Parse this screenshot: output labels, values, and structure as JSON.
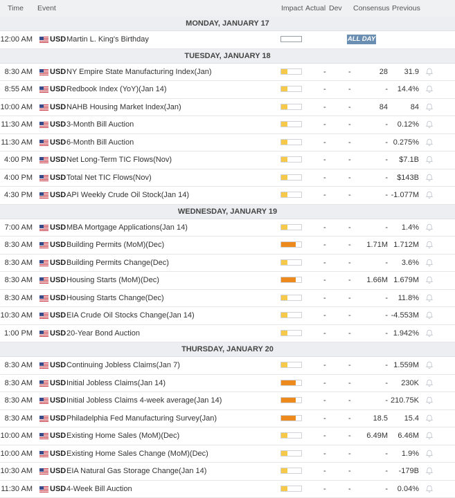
{
  "header": {
    "time": "Time",
    "event": "Event",
    "impact": "Impact",
    "actual": "Actual",
    "dev": "Dev",
    "consensus": "Consensus",
    "previous": "Previous"
  },
  "colors": {
    "impact_low": "#f6c94a",
    "impact_medium": "#ec8a1d",
    "all_day_badge": "#6b8eb3"
  },
  "days": [
    {
      "label": "MONDAY, JANUARY 17",
      "rows": [
        {
          "time": "12:00 AM",
          "currency": "USD",
          "event": "Martin L. King's Birthday",
          "impact": "none",
          "badge": "ALL DAY"
        }
      ]
    },
    {
      "label": "TUESDAY, JANUARY 18",
      "rows": [
        {
          "time": "8:30 AM",
          "currency": "USD",
          "event": "NY Empire State Manufacturing Index(Jan)",
          "impact": "low",
          "actual": "-",
          "dev": "-",
          "consensus": "28",
          "previous": "31.9"
        },
        {
          "time": "8:55 AM",
          "currency": "USD",
          "event": "Redbook Index (YoY)(Jan 14)",
          "impact": "low",
          "actual": "-",
          "dev": "-",
          "consensus": "-",
          "previous": "14.4%"
        },
        {
          "time": "10:00 AM",
          "currency": "USD",
          "event": "NAHB Housing Market Index(Jan)",
          "impact": "low",
          "actual": "-",
          "dev": "-",
          "consensus": "84",
          "previous": "84"
        },
        {
          "time": "11:30 AM",
          "currency": "USD",
          "event": "3-Month Bill Auction",
          "impact": "low",
          "actual": "-",
          "dev": "-",
          "consensus": "-",
          "previous": "0.12%"
        },
        {
          "time": "11:30 AM",
          "currency": "USD",
          "event": "6-Month Bill Auction",
          "impact": "low",
          "actual": "-",
          "dev": "-",
          "consensus": "-",
          "previous": "0.275%"
        },
        {
          "time": "4:00 PM",
          "currency": "USD",
          "event": "Net Long-Term TIC Flows(Nov)",
          "impact": "low",
          "actual": "-",
          "dev": "-",
          "consensus": "-",
          "previous": "$7.1B"
        },
        {
          "time": "4:00 PM",
          "currency": "USD",
          "event": "Total Net TIC Flows(Nov)",
          "impact": "low",
          "actual": "-",
          "dev": "-",
          "consensus": "-",
          "previous": "$143B"
        },
        {
          "time": "4:30 PM",
          "currency": "USD",
          "event": "API Weekly Crude Oil Stock(Jan 14)",
          "impact": "low",
          "actual": "-",
          "dev": "-",
          "consensus": "-",
          "previous": "-1.077M"
        }
      ]
    },
    {
      "label": "WEDNESDAY, JANUARY 19",
      "rows": [
        {
          "time": "7:00 AM",
          "currency": "USD",
          "event": "MBA Mortgage Applications(Jan 14)",
          "impact": "low",
          "actual": "-",
          "dev": "-",
          "consensus": "-",
          "previous": "1.4%"
        },
        {
          "time": "8:30 AM",
          "currency": "USD",
          "event": "Building Permits (MoM)(Dec)",
          "impact": "medium",
          "actual": "-",
          "dev": "-",
          "consensus": "1.71M",
          "previous": "1.712M"
        },
        {
          "time": "8:30 AM",
          "currency": "USD",
          "event": "Building Permits Change(Dec)",
          "impact": "low",
          "actual": "-",
          "dev": "-",
          "consensus": "-",
          "previous": "3.6%"
        },
        {
          "time": "8:30 AM",
          "currency": "USD",
          "event": "Housing Starts (MoM)(Dec)",
          "impact": "medium",
          "actual": "-",
          "dev": "-",
          "consensus": "1.66M",
          "previous": "1.679M"
        },
        {
          "time": "8:30 AM",
          "currency": "USD",
          "event": "Housing Starts Change(Dec)",
          "impact": "low",
          "actual": "-",
          "dev": "-",
          "consensus": "-",
          "previous": "11.8%"
        },
        {
          "time": "10:30 AM",
          "currency": "USD",
          "event": "EIA Crude Oil Stocks Change(Jan 14)",
          "impact": "low",
          "actual": "-",
          "dev": "-",
          "consensus": "-",
          "previous": "-4.553M"
        },
        {
          "time": "1:00 PM",
          "currency": "USD",
          "event": "20-Year Bond Auction",
          "impact": "low",
          "actual": "-",
          "dev": "-",
          "consensus": "-",
          "previous": "1.942%"
        }
      ]
    },
    {
      "label": "THURSDAY, JANUARY 20",
      "rows": [
        {
          "time": "8:30 AM",
          "currency": "USD",
          "event": "Continuing Jobless Claims(Jan 7)",
          "impact": "low",
          "actual": "-",
          "dev": "-",
          "consensus": "-",
          "previous": "1.559M"
        },
        {
          "time": "8:30 AM",
          "currency": "USD",
          "event": "Initial Jobless Claims(Jan 14)",
          "impact": "medium",
          "actual": "-",
          "dev": "-",
          "consensus": "-",
          "previous": "230K"
        },
        {
          "time": "8:30 AM",
          "currency": "USD",
          "event": "Initial Jobless Claims 4-week average(Jan 14)",
          "impact": "medium",
          "actual": "-",
          "dev": "-",
          "consensus": "-",
          "previous": "210.75K"
        },
        {
          "time": "8:30 AM",
          "currency": "USD",
          "event": "Philadelphia Fed Manufacturing Survey(Jan)",
          "impact": "medium",
          "actual": "-",
          "dev": "-",
          "consensus": "18.5",
          "previous": "15.4"
        },
        {
          "time": "10:00 AM",
          "currency": "USD",
          "event": "Existing Home Sales (MoM)(Dec)",
          "impact": "low",
          "actual": "-",
          "dev": "-",
          "consensus": "6.49M",
          "previous": "6.46M"
        },
        {
          "time": "10:00 AM",
          "currency": "USD",
          "event": "Existing Home Sales Change (MoM)(Dec)",
          "impact": "low",
          "actual": "-",
          "dev": "-",
          "consensus": "-",
          "previous": "1.9%"
        },
        {
          "time": "10:30 AM",
          "currency": "USD",
          "event": "EIA Natural Gas Storage Change(Jan 14)",
          "impact": "low",
          "actual": "-",
          "dev": "-",
          "consensus": "-",
          "previous": "-179B"
        },
        {
          "time": "11:30 AM",
          "currency": "USD",
          "event": "4-Week Bill Auction",
          "impact": "low",
          "actual": "-",
          "dev": "-",
          "consensus": "-",
          "previous": "0.04%"
        }
      ]
    }
  ]
}
